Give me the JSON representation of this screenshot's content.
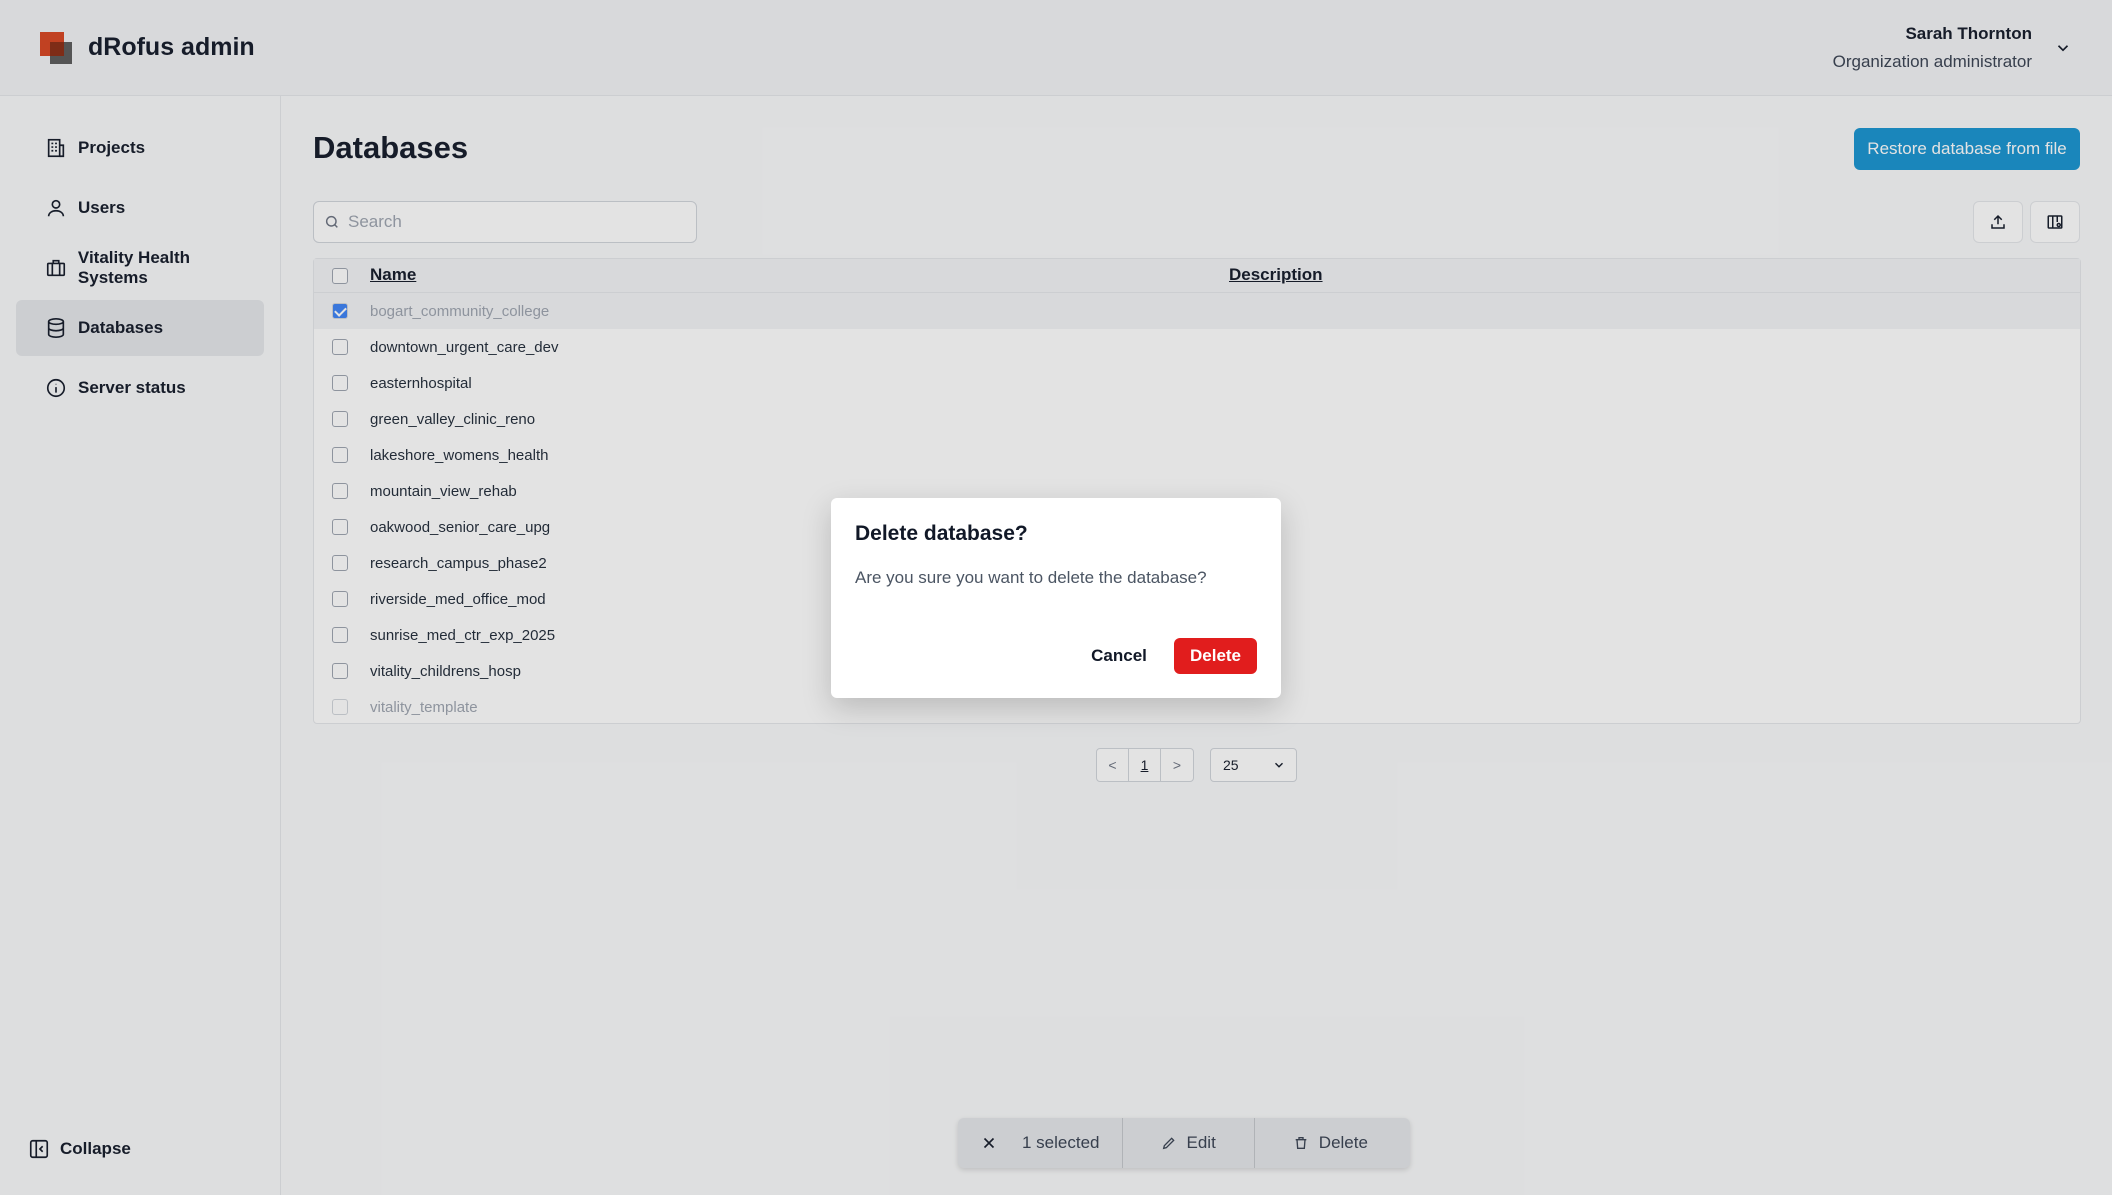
{
  "app": {
    "title": "dRofus admin"
  },
  "user": {
    "name": "Sarah Thornton",
    "role": "Organization administrator"
  },
  "sidebar": {
    "items": [
      {
        "label": "Projects",
        "icon": "building-icon"
      },
      {
        "label": "Users",
        "icon": "user-icon"
      },
      {
        "label": "Vitality Health Systems",
        "icon": "briefcase-icon"
      },
      {
        "label": "Databases",
        "icon": "database-icon",
        "active": true
      },
      {
        "label": "Server status",
        "icon": "info-icon"
      }
    ],
    "collapse_label": "Collapse"
  },
  "main": {
    "title": "Databases",
    "restore_button": "Restore database from file",
    "search_placeholder": "Search",
    "table": {
      "columns": [
        "Name",
        "Description"
      ],
      "rows": [
        {
          "name": "bogart_community_college",
          "selected": true,
          "dim": true
        },
        {
          "name": "downtown_urgent_care_dev"
        },
        {
          "name": "easternhospital"
        },
        {
          "name": "green_valley_clinic_reno"
        },
        {
          "name": "lakeshore_womens_health"
        },
        {
          "name": "mountain_view_rehab"
        },
        {
          "name": "oakwood_senior_care_upg"
        },
        {
          "name": "research_campus_phase2"
        },
        {
          "name": "riverside_med_office_mod"
        },
        {
          "name": "sunrise_med_ctr_exp_2025"
        },
        {
          "name": "vitality_childrens_hosp"
        },
        {
          "name": "vitality_template",
          "dim": true
        }
      ]
    },
    "pagination": {
      "prev": "<",
      "page": "1",
      "next": ">",
      "per_page": "25"
    }
  },
  "action_bar": {
    "selected": "1 selected",
    "edit": "Edit",
    "delete": "Delete"
  },
  "dialog": {
    "title": "Delete database?",
    "body": "Are you sure you want to delete the database?",
    "cancel": "Cancel",
    "confirm": "Delete"
  },
  "colors": {
    "primary": "#1693d1",
    "danger": "#e11d1d",
    "brand": "#d8431f"
  }
}
